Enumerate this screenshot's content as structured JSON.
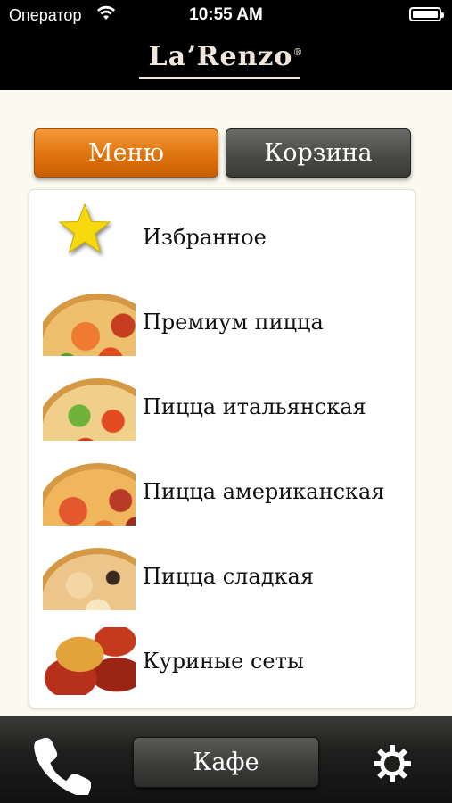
{
  "status_bar": {
    "carrier": "Оператор",
    "time": "10:55 AM"
  },
  "header": {
    "brand_left": "La",
    "brand_right": "Renzo",
    "registered": "®"
  },
  "tabs": {
    "menu": "Меню",
    "cart": "Корзина",
    "active": "menu"
  },
  "menu": {
    "items": [
      {
        "label": "Избранное",
        "icon": "star-icon"
      },
      {
        "label": "Премиум пицца",
        "icon": "pizza-thumb"
      },
      {
        "label": "Пицца итальянская",
        "icon": "pizza-thumb"
      },
      {
        "label": "Пицца американская",
        "icon": "pizza-thumb"
      },
      {
        "label": "Пицца сладкая",
        "icon": "pizza-thumb"
      },
      {
        "label": "Куриные сеты",
        "icon": "chicken-thumb"
      }
    ]
  },
  "bottom_bar": {
    "cafe_label": "Кафе",
    "phone_icon": "phone-icon",
    "settings_icon": "gear-icon"
  },
  "colors": {
    "accent": "#e0730d",
    "dark": "#3a3a37",
    "background": "#fbfaf0"
  }
}
